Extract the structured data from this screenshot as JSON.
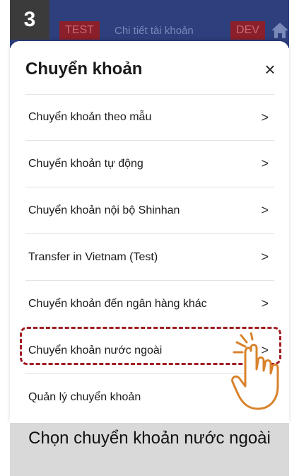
{
  "step_number": "3",
  "appbar": {
    "badge_left": "TEST",
    "title": "Chi tiết tài khoản",
    "badge_right": "DEV",
    "home_icon": "home-icon"
  },
  "sheet": {
    "title": "Chuyển khoản",
    "close_label": "×",
    "items": [
      {
        "label": "Chuyển khoản theo mẫu",
        "chevron": ">"
      },
      {
        "label": "Chuyển khoản tự động",
        "chevron": ">"
      },
      {
        "label": "Chuyển khoản nội bộ Shinhan",
        "chevron": ">"
      },
      {
        "label": "Transfer in Vietnam (Test)",
        "chevron": ">"
      },
      {
        "label": "Chuyển khoản đến ngân hàng khác",
        "chevron": ">"
      },
      {
        "label": "Chuyển khoản nước ngoài",
        "chevron": ">"
      },
      {
        "label": "Quản lý chuyển khoản",
        "chevron": ">"
      }
    ]
  },
  "caption": "Chọn chuyển khoản nước ngoài",
  "colors": {
    "appbar": "#2d3f7d",
    "badge": "#8b1f2a",
    "highlight": "#a01c22",
    "hand_stroke": "#d9822b"
  }
}
